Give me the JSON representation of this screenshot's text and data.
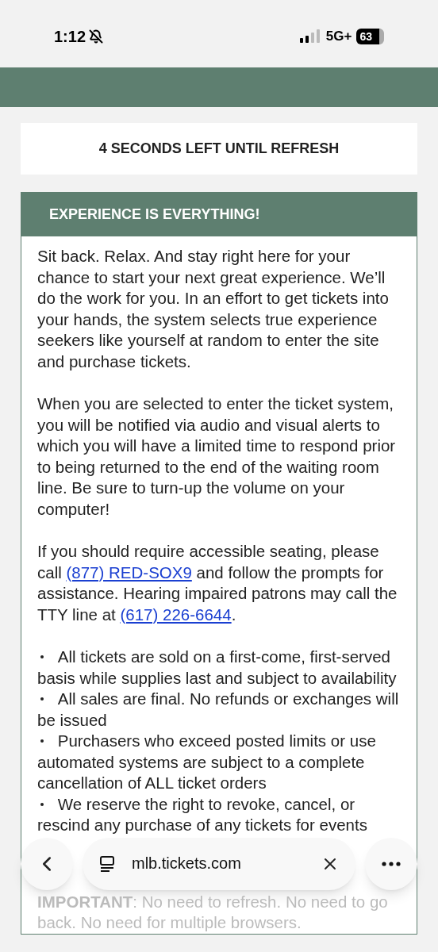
{
  "status_bar": {
    "time": "1:12",
    "network": "5G+",
    "battery": "63",
    "silent": true
  },
  "countdown": "4 SECONDS LEFT UNTIL REFRESH",
  "card": {
    "title": "EXPERIENCE IS EVERYTHING!",
    "paragraphs": [
      [
        {
          "kind": "text",
          "text": "Sit back. Relax. And stay right here for your chance to start your next great experience. We’ll do the work for you. In an effort to get tickets into your hands, the system selects true experience seekers like yourself at random to enter the site and purchase tickets."
        }
      ],
      [
        {
          "kind": "text",
          "text": "When you are selected to enter the ticket system, you will be notified via audio and visual alerts to which you will have a limited time to respond prior to being returned to the end of the waiting room line. Be sure to turn-up the volume on your computer!"
        }
      ],
      [
        {
          "kind": "text",
          "text": "If you should require accessible seating, please call "
        },
        {
          "kind": "link",
          "text": "(877) RED-SOX9"
        },
        {
          "kind": "text",
          "text": " and follow the prompts for assistance. Hearing impaired patrons may call the TTY line at "
        },
        {
          "kind": "link",
          "text": "(617) 226-6644"
        },
        {
          "kind": "text",
          "text": "."
        }
      ]
    ],
    "bullets": [
      "All tickets are sold on a first-come, first-served basis while supplies last and subject to availability",
      "All sales are final. No refunds or exchanges will be issued",
      "Purchasers who exceed posted limits or use automated systems are subject to a complete cancellation of ALL ticket orders",
      "We reserve the right to revoke, cancel, or rescind any purchase of any tickets for events"
    ],
    "notice": "**IMPORTANT**: No need to refresh. No need to go back. No need for multiple browsers."
  },
  "browser_bar": {
    "url": "mlb.tickets.com"
  }
}
